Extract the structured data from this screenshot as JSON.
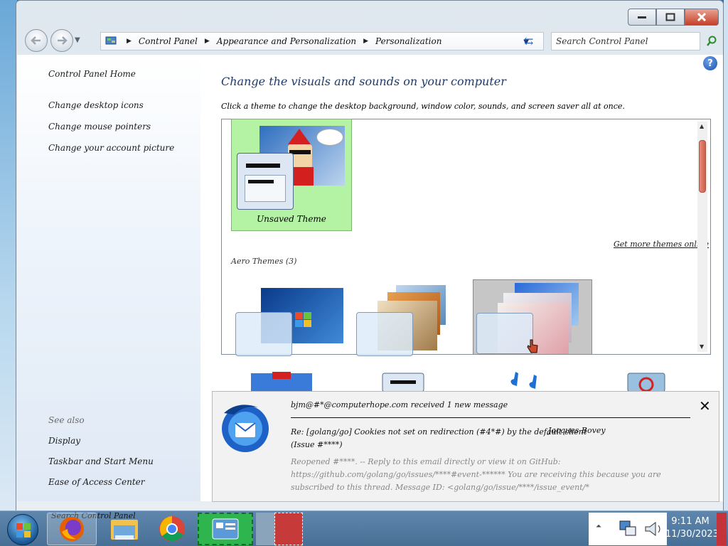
{
  "address_bar": {
    "breadcrumbs": [
      "Control Panel",
      "Appearance and Personalization",
      "Personalization"
    ],
    "search_placeholder": "Search Control Panel"
  },
  "left_pane": {
    "home": "Control Panel Home",
    "links": [
      "Change desktop icons",
      "Change mouse pointers",
      "Change your account picture"
    ],
    "see_also_title": "See also",
    "see_also": [
      "Display",
      "Taskbar and Start Menu",
      "Ease of Access Center"
    ]
  },
  "main": {
    "heading": "Change the visuals and sounds on your computer",
    "subheading": "Click a theme to change the desktop background, window color, sounds, and screen saver all at once.",
    "unsaved_theme": "Unsaved Theme",
    "get_more": "Get more themes online",
    "aero_label": "Aero Themes (3)"
  },
  "notification": {
    "from": "bjm@#*@computerhope.com received 1 new message",
    "subject": "Re: [golang/go] Cookies not set on redirection (#4*#) by the default client",
    "subject_tail": "(Issue #****)",
    "author": "Jacques Bovey",
    "body": "Reopened #****. -- Reply to this email directly or view it on GitHub: https://github.com/golang/go/issues/****#event-****** You are receiving this because you are subscribed to this thread. Message ID: <golang/go/issue/****/issue_event/*"
  },
  "taskbar": {
    "pinned_label": "Search Control Panel",
    "time": "9:11 AM",
    "date": "11/30/2023"
  },
  "icons": [
    "back-icon",
    "forward-icon",
    "control-panel-icon",
    "refresh-icon",
    "search-icon",
    "help-icon",
    "thunderbird-icon",
    "firefox-icon",
    "explorer-icon",
    "chrome-icon",
    "control-panel-taskbar-icon"
  ],
  "colors": {
    "unsaved_bg": "#b4f2a4",
    "heading": "#1e3a6a",
    "taskbar": "#5f87ad",
    "close_button": "#c5402a"
  }
}
